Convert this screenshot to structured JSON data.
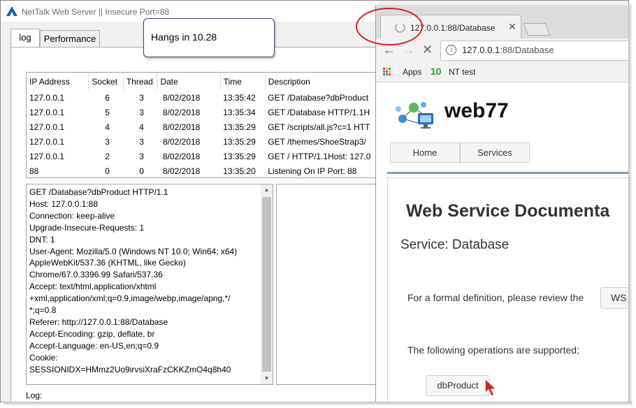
{
  "nettalk": {
    "title": "NetTalk Web Server ||  Insecure Port=88",
    "tabs": [
      {
        "label": "log"
      },
      {
        "label": "Performance"
      }
    ],
    "table": {
      "headers": [
        "IP Address",
        "Socket",
        "Thread",
        "Date",
        "Time",
        "Description"
      ],
      "rows": [
        [
          "127.0.0.1",
          "6",
          "3",
          "8/02/2018",
          "13:35:42",
          "GET /Database?dbProduct"
        ],
        [
          "127.0.0.1",
          "5",
          "3",
          "8/02/2018",
          "13:35:34",
          "GET /Database HTTP/1.1H"
        ],
        [
          "127.0.0.1",
          "4",
          "4",
          "8/02/2018",
          "13:35:29",
          "GET /scripts/all.js?c=1 HTT"
        ],
        [
          "127.0.0.1",
          "3",
          "3",
          "8/02/2018",
          "13:35:29",
          "GET /themes/ShoeStrap3/"
        ],
        [
          "127.0.0.1",
          "2",
          "3",
          "8/02/2018",
          "13:35:29",
          "GET / HTTP/1.1Host: 127.0"
        ],
        [
          "88",
          "0",
          "0",
          "8/02/2018",
          "13:35:20",
          "Listening On IP Port: 88"
        ]
      ]
    },
    "request_lines": [
      "GET /Database?dbProduct HTTP/1.1",
      "Host: 127.0.0.1:88",
      "Connection: keep-alive",
      "Upgrade-Insecure-Requests: 1",
      "DNT: 1",
      "User-Agent: Mozilla/5.0 (Windows NT 10.0; Win64; x64)",
      "AppleWebKit/537.36 (KHTML, like Gecko)",
      "Chrome/67.0.3396.99 Safari/537.36",
      "Accept: text/html,application/xhtml",
      "+xml,application/xml;q=0.9,image/webp,image/apng,*/",
      "*;q=0.8",
      "Referer: http://127.0.0.1:88/Database",
      "Accept-Encoding: gzip, deflate, br",
      "Accept-Language: en-US,en;q=0.9",
      "Cookie:",
      "SESSIONIDX=HMmz2Uo9irvsiXraFzCKKZmO4q8h40"
    ],
    "log_label": "Log:"
  },
  "callout": {
    "text": "Hangs in 10.28"
  },
  "browser": {
    "tab_title": "127.0.0.1:88/Database",
    "url_host": "127.0.0.1",
    "url_path": ":88/Database",
    "bookmarks": {
      "apps": "Apps",
      "nt_icon": "10",
      "nt_test": "NT test"
    },
    "page": {
      "site_name": "web77",
      "nav": [
        "Home",
        "Services"
      ],
      "doc_title": "Web Service Documenta",
      "service": "Service: Database",
      "formal_text": "For a formal definition, please review the",
      "wsdl_button": "WS",
      "ops_text": "The following operations are supported;",
      "operation_button": "dbProduct"
    }
  },
  "colors": {
    "annotation_circle": "#e0201e",
    "nav_blue_line": "#7f9db9",
    "bookmark_nt": "#2ba02b"
  }
}
